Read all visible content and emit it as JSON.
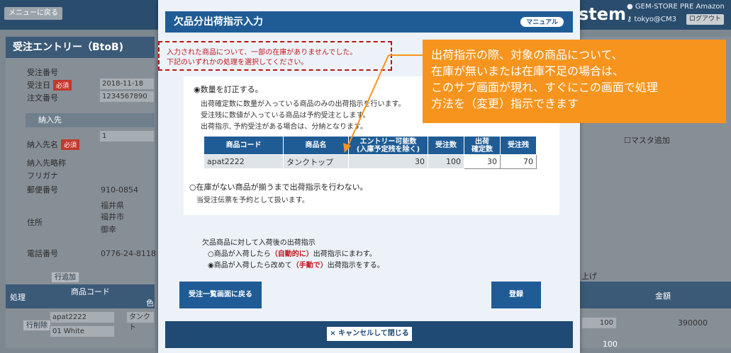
{
  "background": {
    "menu_back": "メニューに戻る",
    "system_name_fragment": "stem",
    "store_name": "GEM-STORE PRE Amazon",
    "user_id": "tokyo@CM3",
    "logout": "ログアウト",
    "panel_title": "受注エントリー（BtoB)",
    "order_id_label": "受注番号",
    "order_date_label": "受注日",
    "order_date_value": "2018-11-18",
    "note_number_label": "注文番号",
    "note_number_value": "1234567890",
    "required": "必須",
    "section_shipto": "納入先",
    "shipto_name_label": "納入先名",
    "shipto_name_value": "1",
    "shipto_short_label": "納入先略称",
    "furigana_label": "フリガナ",
    "zip_label": "郵便番号",
    "zip_value": "910-0854",
    "address_label": "住所",
    "address_line1": "福井県",
    "address_line2": "福井市",
    "address_line3": "御幸",
    "phone_label": "電話番号",
    "phone_value": "0776-24-8118",
    "add_row": "行追加",
    "col_action": "処理",
    "col_product_code": "商品コード",
    "col_color": "色",
    "row_product_code": "apat2222",
    "row_product_name": "タンクト",
    "row_delete": "行削除",
    "row_color": "01 White",
    "master_add": "マスタ追加",
    "partial_label": "上げ",
    "col_amount": "金額",
    "row_qty": "100",
    "row_amount": "390000",
    "total_qty": "100"
  },
  "modal": {
    "title": "欠品分出荷指示入力",
    "manual_button": "マニュアル",
    "notice_line1": "入力された商品について、一部の在庫がありませんでした。",
    "notice_line2": "下記のいずれかの処理を選択してください。",
    "option1_label": "◉数量を訂正する。",
    "option1_desc1": "出荷確定数に数量が入っている商品のみの出荷指示を行います。",
    "option1_desc2": "受注残に数値が入っている商品は予約受注とします。",
    "option1_desc3": "出荷指示, 予約受注がある場合は、分納となります。",
    "table_headers": [
      "商品コード",
      "商品名",
      "エントリー可能数\n(入庫予定残を除く)",
      "受注数",
      "出荷\n確定数",
      "受注残"
    ],
    "table_rows": [
      {
        "code": "apat2222",
        "name": "タンクトップ",
        "available": "30",
        "ordered": "100",
        "confirmed": "30",
        "remaining": "70"
      }
    ],
    "option2_label": "○在庫がない商品が揃うまで出荷指示を行わない。",
    "option2_desc": "当受注伝票を予約として扱います。",
    "after_arrival_title": "欠品商品に対して入荷後の出荷指示",
    "radio_auto_pre": "○商品が入荷したら",
    "radio_auto_hl": "（自動的に）",
    "radio_auto_post": "出荷指示にまわす。",
    "radio_manual_pre": "◉商品が入荷したら改めて",
    "radio_manual_hl": "（手動で）",
    "radio_manual_post": "出荷指示をする。",
    "back_button": "受注一覧画面に戻る",
    "register_button": "登録",
    "close_button": "× キャンセルして閉じる"
  },
  "callout": {
    "line1": "出荷指示の際、対象の商品について、",
    "line2": "在庫が無いまたは在庫不足の場合は、",
    "line3": "このサブ画面が現れ、すぐにこの画面で処理",
    "line4": "方法を（変更）指示できます"
  },
  "colors": {
    "accent": "#1f5c95",
    "warning": "#c4161c",
    "callout": "#f7941d"
  }
}
